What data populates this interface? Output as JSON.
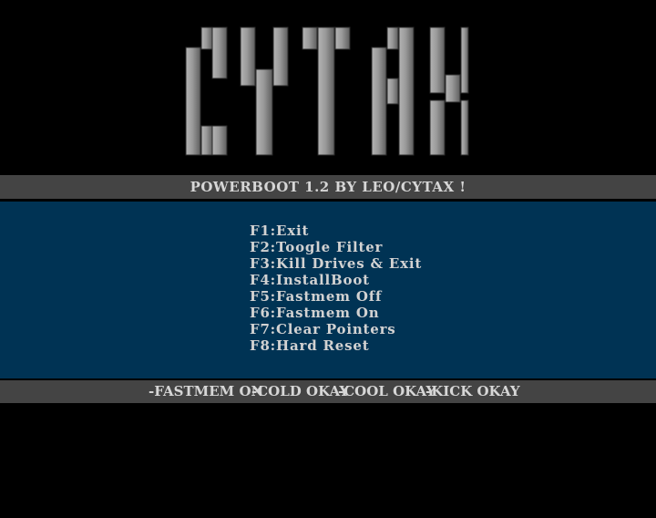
{
  "logo": {
    "text": "CYTAX"
  },
  "title_bar": {
    "text": "POWERBOOT 1.2 BY LEO/CYTAX !"
  },
  "menu": {
    "items": [
      {
        "key": "F1",
        "label": "F1:Exit"
      },
      {
        "key": "F2",
        "label": "F2:Toogle Filter"
      },
      {
        "key": "F3",
        "label": "F3:Kill Drives & Exit"
      },
      {
        "key": "F4",
        "label": "F4:InstallBoot"
      },
      {
        "key": "F5",
        "label": "F5:Fastmem Off"
      },
      {
        "key": "F6",
        "label": "F6:Fastmem On"
      },
      {
        "key": "F7",
        "label": "F7:Clear Pointers"
      },
      {
        "key": "F8",
        "label": "F8:Hard Reset"
      }
    ]
  },
  "status_bar": {
    "fastmem": "-FASTMEM ON",
    "cold": "-COLD OKAY",
    "cool": "-COOL OKAY",
    "kick": "-KICK OKAY"
  },
  "colors": {
    "background": "#000000",
    "bar_gray": "#444444",
    "panel_blue": "#003354",
    "text_light": "#d2d2d2",
    "logo_light": "#a0a0a0",
    "logo_dark": "#5a5a5a"
  }
}
